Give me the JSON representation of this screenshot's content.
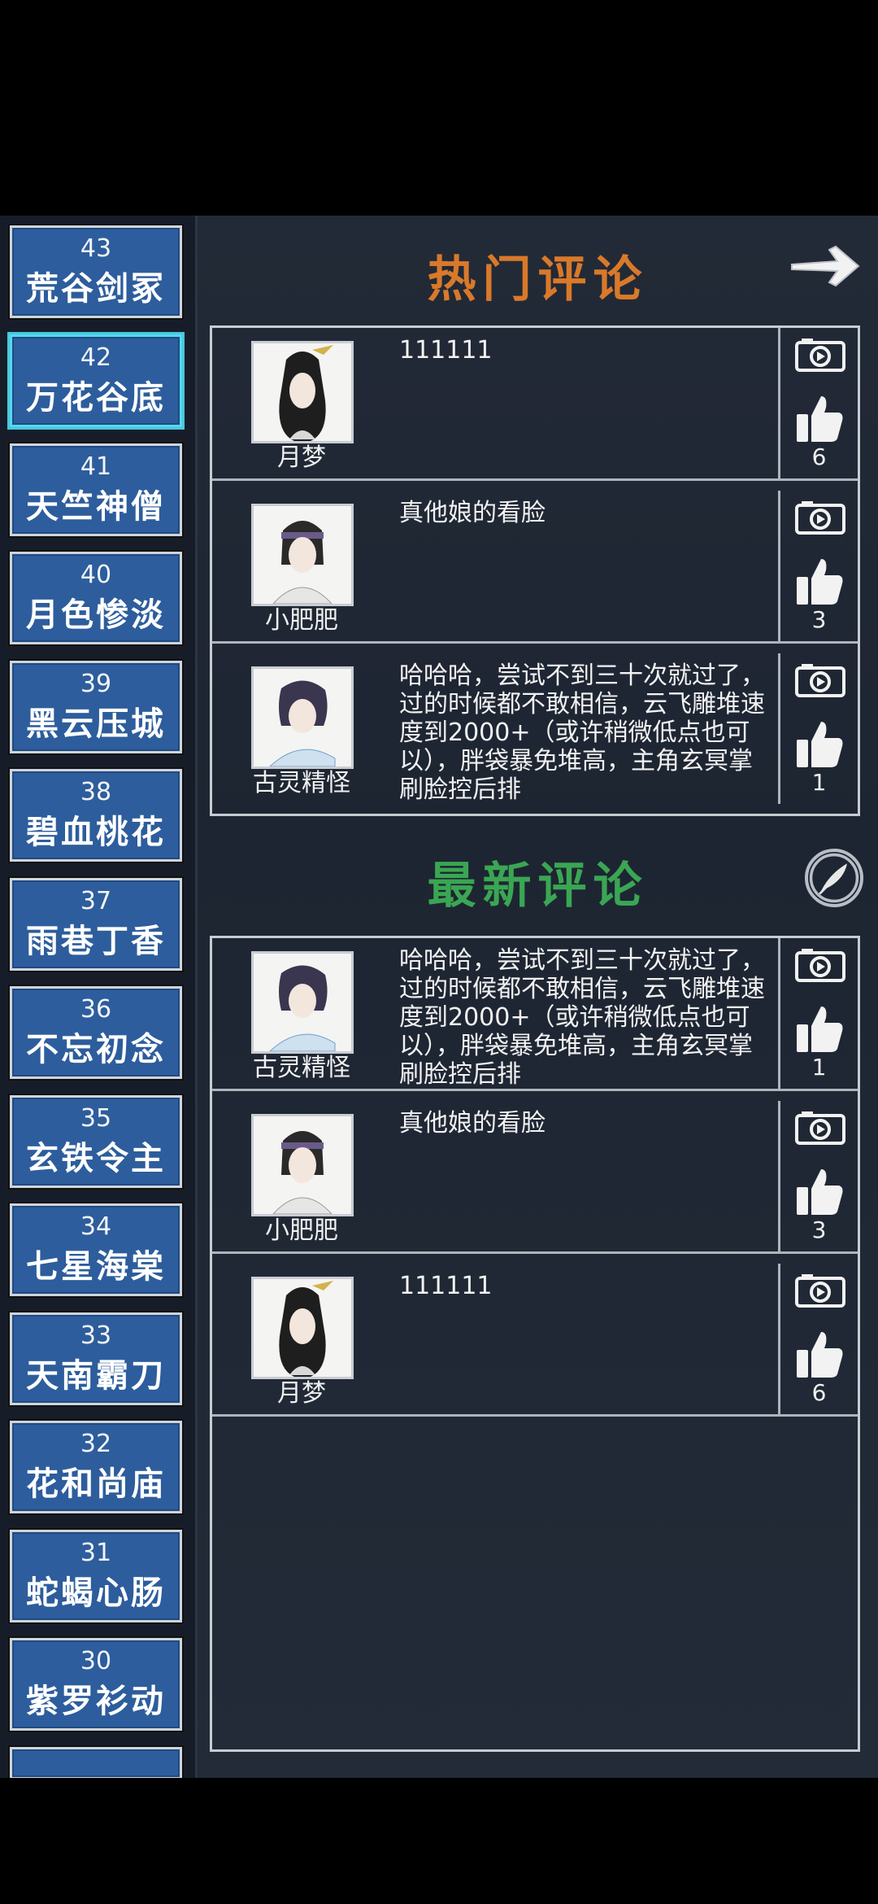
{
  "levels": [
    {
      "num": "43",
      "name": "荒谷剑冢"
    },
    {
      "num": "42",
      "name": "万花谷底"
    },
    {
      "num": "41",
      "name": "天竺神僧"
    },
    {
      "num": "40",
      "name": "月色惨淡"
    },
    {
      "num": "39",
      "name": "黑云压城"
    },
    {
      "num": "38",
      "name": "碧血桃花"
    },
    {
      "num": "37",
      "name": "雨巷丁香"
    },
    {
      "num": "36",
      "name": "不忘初念"
    },
    {
      "num": "35",
      "name": "玄铁令主"
    },
    {
      "num": "34",
      "name": "七星海棠"
    },
    {
      "num": "33",
      "name": "天南霸刀"
    },
    {
      "num": "32",
      "name": "花和尚庙"
    },
    {
      "num": "31",
      "name": "蛇蝎心肠"
    },
    {
      "num": "30",
      "name": "紫罗衫动"
    }
  ],
  "selected_level": "42",
  "hot": {
    "title": "热门评论",
    "comments": [
      {
        "user": "月梦",
        "text": "111111",
        "likes": "6",
        "avatar_icon": "female-swordswoman-avatar"
      },
      {
        "user": "小肥肥",
        "text": "真他娘的看脸",
        "likes": "3",
        "avatar_icon": "male-headband-avatar"
      },
      {
        "user": "古灵精怪",
        "text": "哈哈哈，尝试不到三十次就过了，过的时候都不敢相信，云飞雕堆速度到2000+（或许稍微低点也可以），胖袋暴免堆高，主角玄冥掌刷脸控后排",
        "likes": "1",
        "avatar_icon": "girl-avatar"
      }
    ]
  },
  "latest": {
    "title": "最新评论",
    "comments": [
      {
        "user": "古灵精怪",
        "text": "哈哈哈，尝试不到三十次就过了，过的时候都不敢相信，云飞雕堆速度到2000+（或许稍微低点也可以），胖袋暴免堆高，主角玄冥掌刷脸控后排",
        "likes": "1",
        "avatar_icon": "girl-avatar"
      },
      {
        "user": "小肥肥",
        "text": "真他娘的看脸",
        "likes": "3",
        "avatar_icon": "male-headband-avatar"
      },
      {
        "user": "月梦",
        "text": "111111",
        "likes": "6",
        "avatar_icon": "female-swordswoman-avatar"
      }
    ]
  },
  "icons": {
    "next": "right-arrow-icon",
    "write": "quill-pen-icon",
    "replay": "video-camera-icon",
    "like": "thumbs-up-icon"
  },
  "colors": {
    "hot_title": "#d9792a",
    "new_title": "#3aa653",
    "level_tile": "#2d5d9c",
    "selected_border": "#56d8ec"
  }
}
